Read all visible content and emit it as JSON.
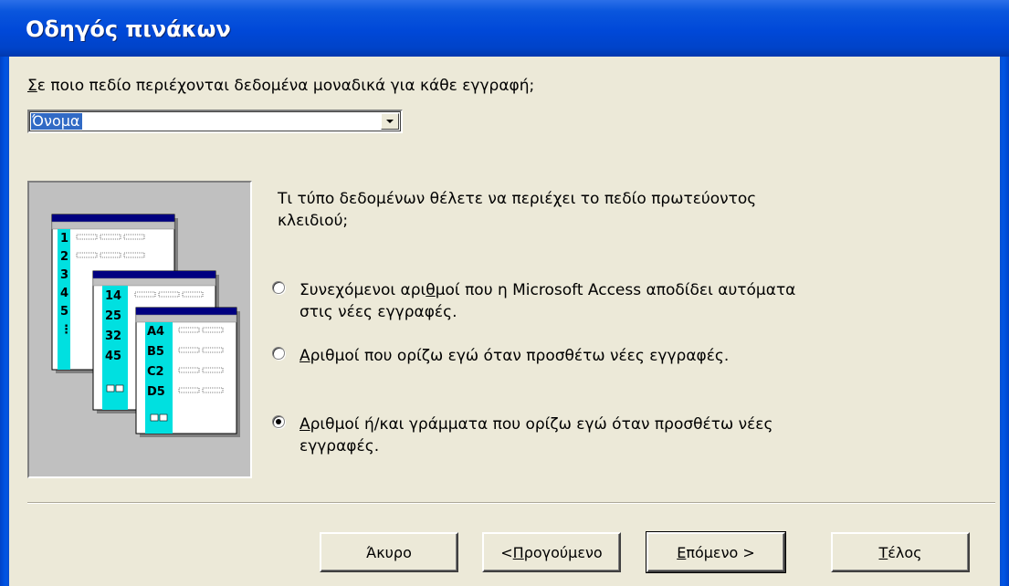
{
  "window": {
    "title": "Οδηγός πινάκων"
  },
  "field_question": {
    "accel": "Σ",
    "rest": "ε ποιο πεδίο περιέχονται δεδομένα μοναδικά για κάθε εγγραφή;"
  },
  "field_select": {
    "value": "Όνομα"
  },
  "illustration": {
    "back_rows": [
      "1",
      "2",
      "3",
      "4",
      "5",
      "⋮"
    ],
    "middle_rows": [
      "14",
      "25",
      "32",
      "45"
    ],
    "front_rows": [
      "A4",
      "B5",
      "C2",
      "D5"
    ]
  },
  "key_prompt": "Τι τύπο δεδομένων θέλετε να περιέχει το πεδίο πρωτεύοντος κλειδιού;",
  "options": [
    {
      "pre": "Συνεχόμενοι αρι",
      "accel": "θ",
      "post": "μοί που η Microsoft Access αποδίδει αυτόματα στις νέες εγγραφές.",
      "selected": false
    },
    {
      "pre": "",
      "accel": "Α",
      "post": "ριθμοί που ορίζω εγώ όταν προσθέτω νέες εγγραφές.",
      "selected": false
    },
    {
      "pre": "",
      "accel": "Α",
      "post": "ριθμοί ή/και γράμματα που ορίζω εγώ όταν προσθέτω νέες εγγραφές.",
      "selected": true
    }
  ],
  "buttons": {
    "cancel": "Άκυρο",
    "back_prefix": "< ",
    "back_accel": "Π",
    "back_rest": "ρογούμενο",
    "next_accel": "Ε",
    "next_rest": "πόμενο >",
    "finish_accel": "Τ",
    "finish_rest": "έλος"
  }
}
